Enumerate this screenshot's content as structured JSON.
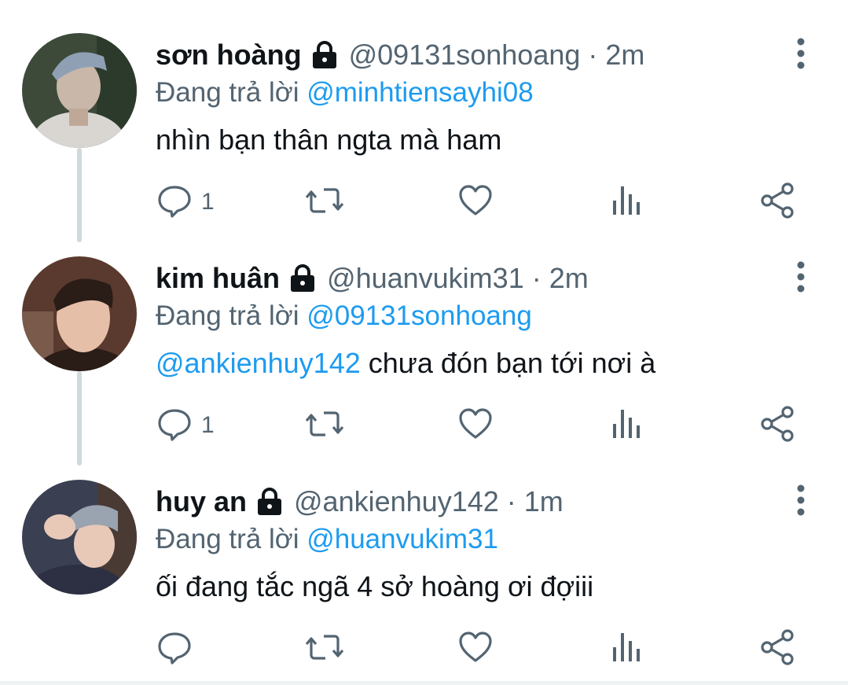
{
  "reply_label": "Đang trả lời",
  "separator": "·",
  "tweets": [
    {
      "name": "sơn hoàng",
      "handle": "@09131sonhoang",
      "time": "2m",
      "replying_to": "@minhtiensayhi08",
      "mention": "",
      "text": "nhìn bạn thân ngta mà ham",
      "reply_count": "1",
      "avatar_colors": [
        "#3d4a3a",
        "#c9b7a9",
        "#8fa0b4"
      ]
    },
    {
      "name": "kim huân",
      "handle": "@huanvukim31",
      "time": "2m",
      "replying_to": "@09131sonhoang",
      "mention": "@ankienhuy142",
      "text": " chưa đón bạn tới nơi à",
      "reply_count": "1",
      "avatar_colors": [
        "#5a3a2e",
        "#e6bfa8",
        "#2a1c17"
      ]
    },
    {
      "name": "huy an",
      "handle": "@ankienhuy142",
      "time": "1m",
      "replying_to": "@huanvukim31",
      "mention": "",
      "text": "ối đang tắc ngã 4 sở hoàng ơi đợiii",
      "reply_count": "",
      "avatar_colors": [
        "#3a3f52",
        "#e8c9b8",
        "#9aa3b0"
      ]
    }
  ],
  "icons": {
    "lock": "lock-icon",
    "more": "more-vertical-icon",
    "reply": "comment-icon",
    "retweet": "retweet-icon",
    "like": "heart-icon",
    "views": "analytics-icon",
    "share": "share-icon"
  },
  "colors": {
    "mention": "#1d9bf0",
    "secondary_text": "#536471",
    "thread_line": "#cfd9de"
  }
}
